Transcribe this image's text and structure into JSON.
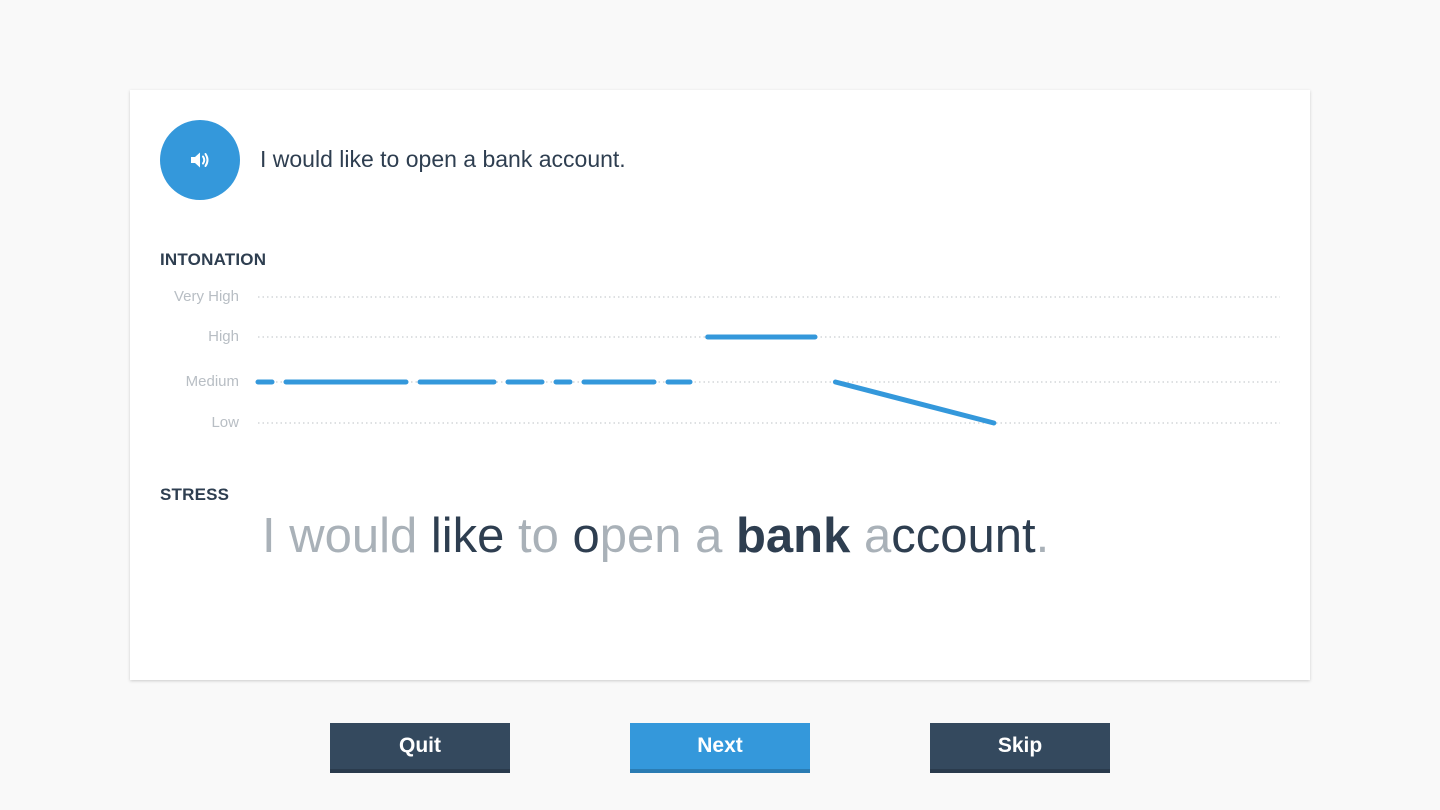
{
  "prompt": {
    "sentence": "I would like to open a bank account."
  },
  "audio_button": {
    "icon": "speaker-icon"
  },
  "intonation": {
    "label": "INTONATION",
    "levels": [
      "Very High",
      "High",
      "Medium",
      "Low"
    ],
    "segments": [
      {
        "level": "Medium",
        "style": "dashed",
        "from": 0.0,
        "to": 0.43
      },
      {
        "level": "High",
        "style": "solid",
        "from": 0.44,
        "to": 0.545
      },
      {
        "level": "Medium",
        "style": "solid",
        "from": 0.565,
        "to": 0.72,
        "end_level": "Low"
      }
    ]
  },
  "stress": {
    "label": "STRESS",
    "parts": [
      {
        "text": "I would ",
        "weight": "light"
      },
      {
        "text": "like",
        "weight": "strong"
      },
      {
        "text": " to ",
        "weight": "light"
      },
      {
        "text": "o",
        "weight": "strong"
      },
      {
        "text": "pen a ",
        "weight": "light"
      },
      {
        "text": "bank",
        "weight": "bold"
      },
      {
        "text": " a",
        "weight": "light"
      },
      {
        "text": "ccount",
        "weight": "strong"
      },
      {
        "text": ".",
        "weight": "light"
      }
    ]
  },
  "buttons": {
    "quit": "Quit",
    "next": "Next",
    "skip": "Skip"
  },
  "colors": {
    "accent": "#3498db",
    "dark": "#34495e",
    "text": "#2e3e50",
    "muted": "#b8bec4"
  }
}
